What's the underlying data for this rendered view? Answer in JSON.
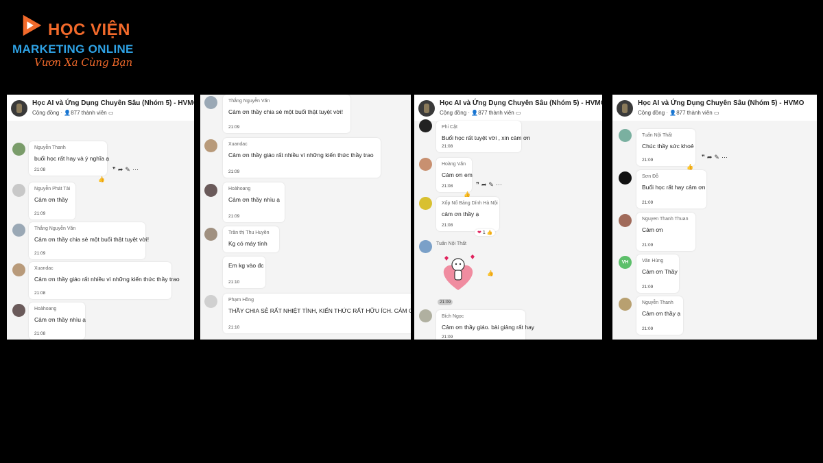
{
  "logo": {
    "line1": "HỌC VIỆN",
    "line2": "MARKETING ONLINE",
    "line3": "Vươn Xa Cùng Bạn"
  },
  "group": {
    "title": "Học AI và Ứng Dụng Chuyên Sâu (Nhóm 5) - HVMO",
    "community": "Cộng đồng",
    "members": "877 thành viên"
  },
  "icons": {
    "quote": "quote-icon",
    "share": "share-icon",
    "edit": "edit-icon",
    "more": "more-icon",
    "like": "like-icon"
  },
  "panel1": [
    {
      "name": "Nguyễn Thanh",
      "text": "buổi học rất hay và ý nghĩa ạ",
      "time": "21:08"
    },
    {
      "name": "Nguyễn Phát Tài",
      "text": "Cảm ơn thầy",
      "time": "21:09"
    },
    {
      "name": "Thắng Nguyễn Văn",
      "text": "Cảm ơn thầy chia sẻ một buổi thật tuyệt vời!",
      "time": "21:09"
    },
    {
      "name": "Xuandac",
      "text": "Cảm ơn thầy giáo rất nhiều vì những kiến thức thầy trao",
      "time": "21:08"
    },
    {
      "name": "Hoàhoang",
      "text": "Cảm ơn thầy  nhìu ạ",
      "time": "21:08"
    }
  ],
  "panel2": [
    {
      "name": "Thắng Nguyễn Văn",
      "text": "Cảm ơn thầy chia sẻ một buổi thật tuyệt vời!",
      "time": "21:09"
    },
    {
      "name": "Xuandac",
      "text": "Cảm ơn thầy giáo rất nhiều vì những kiến thức thầy trao",
      "time": "21:09"
    },
    {
      "name": "Hoàhoang",
      "text": "Cảm ơn thầy  nhìu ạ",
      "time": "21:09"
    },
    {
      "name": "Trần thị Thu Huyền",
      "text": "Kg có máy tính",
      "time": ""
    },
    {
      "name": "",
      "text": "Em kg vào đc",
      "time": "21:10"
    },
    {
      "name": "Phạm Hồng",
      "text": "THẦY CHIA SẺ RẤT NHIỆT TÌNH, KIẾN THỨC RẤT HỮU ÍCH. CẢM ƠN T",
      "time": "21:10"
    }
  ],
  "panel3": [
    {
      "name": "Phi Cật",
      "text": "Buổi học rất tuyệt vời , xin cảm ơn",
      "time": "21:08"
    },
    {
      "name": "Hoàng Văn",
      "text": "Cảm ơn em",
      "time": "21:08"
    },
    {
      "name": "Xốp Nổ Bảng Dính Hà Nội",
      "text": "cảm ơn thầy ạ",
      "time": "21:08"
    },
    {
      "name": "Tuấn Nội Thất",
      "text": "",
      "time": "21:09"
    },
    {
      "name": "Bích Ngọc",
      "text": "Cảm ơn thầy giáo. bài giảng rất hay",
      "time": "21:09"
    }
  ],
  "panel3_reaction": {
    "emoji": "❤",
    "count": "1"
  },
  "panel4": [
    {
      "name": "Tuấn Nội Thất",
      "text": "Chúc thầy sức khoẻ",
      "time": "21:09"
    },
    {
      "name": "Sơn Đỗ",
      "text": "Buổi học rất hay cảm ơn",
      "time": "21:09"
    },
    {
      "name": "Nguyen Thanh Thuan",
      "text": "Cảm ơn",
      "time": "21:09"
    },
    {
      "name": "Văn Hùng",
      "text": "Cảm ơn Thầy",
      "time": "21:09"
    },
    {
      "name": "Nguyễn Thanh",
      "text": "Cảm  ơn thầy ạ",
      "time": "21:09"
    }
  ],
  "panel4_avatar_initials": "VH",
  "colors": {
    "brand_orange": "#f26a2b",
    "brand_blue": "#2fa3e6",
    "panel_bg": "#f4f4f4"
  }
}
